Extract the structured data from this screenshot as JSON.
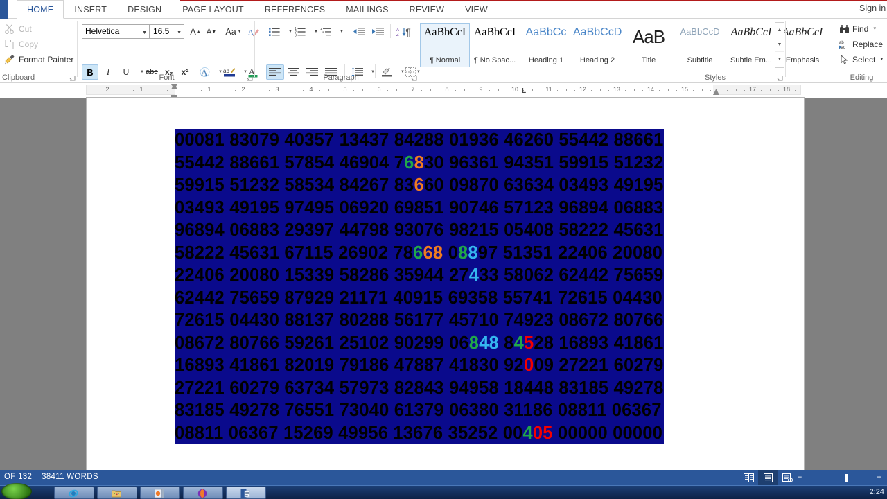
{
  "window": {
    "app": "Microsoft Word",
    "signin_label": "Sign in"
  },
  "ribbon": {
    "tabs": [
      {
        "label": "HOME",
        "active": true
      },
      {
        "label": "INSERT",
        "active": false
      },
      {
        "label": "DESIGN",
        "active": false
      },
      {
        "label": "PAGE LAYOUT",
        "active": false
      },
      {
        "label": "REFERENCES",
        "active": false
      },
      {
        "label": "MAILINGS",
        "active": false
      },
      {
        "label": "REVIEW",
        "active": false
      },
      {
        "label": "VIEW",
        "active": false
      }
    ],
    "groups": {
      "clipboard": {
        "label": "Clipboard",
        "items": [
          {
            "label": "Cut",
            "icon": "scissors-icon",
            "enabled": false
          },
          {
            "label": "Copy",
            "icon": "copy-icon",
            "enabled": false
          },
          {
            "label": "Format Painter",
            "icon": "format-painter-icon",
            "enabled": true
          }
        ]
      },
      "font": {
        "label": "Font",
        "font_name": "Helvetica",
        "font_size": "16.5",
        "grow_font": "A",
        "shrink_font": "A",
        "change_case": "Aa",
        "clear_formatting_icon": "clear-formatting-icon",
        "bold": "B",
        "italic": "I",
        "underline": "U",
        "strikethrough": "abc",
        "subscript": "x₂",
        "superscript": "x²",
        "text_effects": "A",
        "highlight": "ab",
        "font_color": "A",
        "bold_active": true
      },
      "paragraph": {
        "label": "Paragraph",
        "bullets": "bullet-list-icon",
        "numbering": "numbered-list-icon",
        "multilevel": "multilevel-list-icon",
        "decrease_indent": "decrease-indent-icon",
        "increase_indent": "increase-indent-icon",
        "sort": "sort-icon",
        "show_marks": "¶",
        "align_left": "align-left-icon",
        "align_center": "align-center-icon",
        "align_right": "align-right-icon",
        "justify": "justify-icon",
        "line_spacing": "line-spacing-icon",
        "shading": "shading-icon",
        "borders": "borders-icon",
        "align_left_active": true
      },
      "styles": {
        "label": "Styles",
        "items": [
          {
            "preview": "AaBbCcI",
            "name": "¶ Normal",
            "selected": true,
            "style": "serif-normal"
          },
          {
            "preview": "AaBbCcI",
            "name": "¶ No Spac...",
            "selected": false,
            "style": "serif-normal"
          },
          {
            "preview": "AaBbCc",
            "name": "Heading 1",
            "selected": false,
            "style": "heading-blue"
          },
          {
            "preview": "AaBbCcD",
            "name": "Heading 2",
            "selected": false,
            "style": "heading-blue"
          },
          {
            "preview": "AaB",
            "name": "Title",
            "selected": false,
            "style": "title-big"
          },
          {
            "preview": "AaBbCcD",
            "name": "Subtitle",
            "selected": false,
            "style": "subtitle-grey"
          },
          {
            "preview": "AaBbCcI",
            "name": "Subtle Em...",
            "selected": false,
            "style": "italic-serif"
          },
          {
            "preview": "AaBbCcI",
            "name": "Emphasis",
            "selected": false,
            "style": "italic-serif"
          }
        ]
      },
      "editing": {
        "label": "Editing",
        "items": [
          {
            "label": "Find",
            "icon": "binoculars-icon",
            "has_caret": true
          },
          {
            "label": "Replace",
            "icon": "replace-icon",
            "has_caret": false
          },
          {
            "label": "Select",
            "icon": "select-arrow-icon",
            "has_caret": true
          }
        ]
      }
    }
  },
  "ruler": {
    "left_labels": [
      "2",
      "1"
    ],
    "labels": [
      "1",
      "2",
      "3",
      "4",
      "5",
      "6",
      "7",
      "8",
      "9",
      "10",
      "11",
      "12",
      "13",
      "14",
      "15",
      "17",
      "18"
    ],
    "tab_stop_marker": "L",
    "first_line_indent_marker": "first-line-indent-icon",
    "right_indent_marker": "right-indent-icon"
  },
  "document": {
    "selection_bg": "#0a0a8c",
    "text_color": "#000000",
    "colors": {
      "green": "#21a84a",
      "orange": "#f07c20",
      "cyan": "#35b6f0",
      "red": "#f40000"
    },
    "lines": [
      [
        {
          "t": "00081 83079 40357 13437 84288 01936 46260 55442 88661",
          "c": "black"
        }
      ],
      [
        {
          "t": "55442 88661 57854 46904 7",
          "c": "black"
        },
        {
          "t": "6",
          "c": "green"
        },
        {
          "t": "8",
          "c": "orange"
        },
        {
          "t": "30 96361 94351 59915 51232",
          "c": "black"
        }
      ],
      [
        {
          "t": "59915 51232 58534 84267 83",
          "c": "black"
        },
        {
          "t": "6",
          "c": "orange"
        },
        {
          "t": "60 09870 63634 03493 49195",
          "c": "black"
        }
      ],
      [
        {
          "t": "03493 49195 97495 06920 69851 90746 57123 96894 06883",
          "c": "black"
        }
      ],
      [
        {
          "t": "96894 06883 29397 44798 93076 98215 05408 58222 45631",
          "c": "black"
        }
      ],
      [
        {
          "t": "58222 45631 67115 26902 78",
          "c": "black"
        },
        {
          "t": "6",
          "c": "green"
        },
        {
          "t": "68",
          "c": "orange"
        },
        {
          "t": " 0",
          "c": "black"
        },
        {
          "t": "8",
          "c": "green"
        },
        {
          "t": "8",
          "c": "cyan"
        },
        {
          "t": "97 51351 22406 20080",
          "c": "black"
        }
      ],
      [
        {
          "t": "22406 20080 15339 58286 35944 27",
          "c": "black"
        },
        {
          "t": "4",
          "c": "cyan"
        },
        {
          "t": "33 58062 62442 75659",
          "c": "black"
        }
      ],
      [
        {
          "t": "62442 75659 87929 21171 40915 69358 55741 72615 04430",
          "c": "black"
        }
      ],
      [
        {
          "t": "72615 04430 88137 80288 56177 45710 74923 08672 80766",
          "c": "black"
        }
      ],
      [
        {
          "t": "08672 80766 59261 25102 90299 06",
          "c": "black"
        },
        {
          "t": "8",
          "c": "green"
        },
        {
          "t": "48",
          "c": "cyan"
        },
        {
          "t": " 8",
          "c": "black"
        },
        {
          "t": "4",
          "c": "green"
        },
        {
          "t": "5",
          "c": "red"
        },
        {
          "t": "28 16893 41861",
          "c": "black"
        }
      ],
      [
        {
          "t": "16893 41861 82019 79186 47887 41830 92",
          "c": "black"
        },
        {
          "t": "0",
          "c": "red"
        },
        {
          "t": "09 27221 60279",
          "c": "black"
        }
      ],
      [
        {
          "t": "27221 60279 63734 57973 82843 94958 18448 83185 49278",
          "c": "black"
        }
      ],
      [
        {
          "t": "83185 49278 76551 73040 61379 06380 31186 08811 06367",
          "c": "black"
        }
      ],
      [
        {
          "t": "08811 06367 15269 49956 13676 35252 00",
          "c": "black"
        },
        {
          "t": "4",
          "c": "green"
        },
        {
          "t": "05",
          "c": "red"
        },
        {
          "t": " 00000 00000",
          "c": "black"
        }
      ]
    ]
  },
  "statusbar": {
    "page_label": "OF 132",
    "words_label": "38411 WORDS",
    "views": [
      {
        "name": "read-mode",
        "active": false
      },
      {
        "name": "print-layout",
        "active": true
      },
      {
        "name": "web-layout",
        "active": false
      }
    ],
    "zoom_out": "−",
    "zoom_in": "+"
  },
  "taskbar": {
    "start": "start-button",
    "items": [
      "internet-explorer-icon",
      "file-explorer-icon",
      "media-player-icon",
      "opera-icon",
      "word-icon"
    ],
    "clock": "2:24"
  }
}
